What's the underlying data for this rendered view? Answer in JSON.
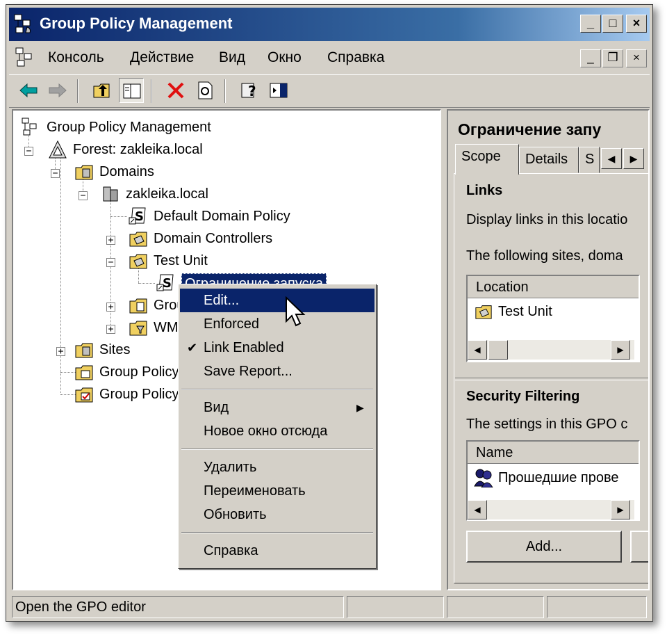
{
  "window": {
    "title": "Group Policy Management",
    "caption_buttons": [
      "_",
      "□",
      "×"
    ]
  },
  "menubar": {
    "items": [
      "Консоль",
      "Действие",
      "Вид",
      "Окно",
      "Справка"
    ]
  },
  "toolbar": {
    "buttons": [
      "back-icon",
      "forward-icon",
      "up-one-level-icon",
      "show-hide-tree-icon",
      "delete-icon",
      "refresh-icon",
      "help-icon",
      "show-hide-action-pane-icon"
    ]
  },
  "tree": {
    "root": "Group Policy Management",
    "forest": "Forest: zakleika.local",
    "domains": "Domains",
    "domain": "zakleika.local",
    "default_policy": "Default Domain Policy",
    "domain_controllers": "Domain Controllers",
    "test_unit": "Test Unit",
    "selected_link": "Ограничение запуска",
    "group_policy_objects_trunc": "Grou",
    "wmi_trunc": "WM",
    "sites": "Sites",
    "gp_modeling_trunc": "Group Policy",
    "gp_results_trunc": "Group Policy"
  },
  "context_menu": {
    "edit": "Edit...",
    "enforced": "Enforced",
    "link_enabled": "Link Enabled",
    "link_enabled_checked": true,
    "save_report": "Save Report...",
    "view": "Вид",
    "new_window": "Новое окно отсюда",
    "delete": "Удалить",
    "rename": "Переименовать",
    "refresh": "Обновить",
    "help": "Справка"
  },
  "right_pane": {
    "title": "Ограничение запу",
    "tabs": [
      "Scope",
      "Details",
      "S"
    ],
    "active_tab": "Scope",
    "links_heading": "Links",
    "display_links_text": "Display links in this locatio",
    "following_sites_text": "The following sites, doma",
    "links_table": {
      "column": "Location",
      "rows": [
        "Test Unit"
      ]
    },
    "security_heading": "Security Filtering",
    "security_text": "The settings in this GPO c",
    "security_table": {
      "column": "Name",
      "rows": [
        "Прошедшие прове"
      ]
    },
    "add_button": "Add..."
  },
  "statusbar": {
    "text": "Open the GPO editor"
  }
}
